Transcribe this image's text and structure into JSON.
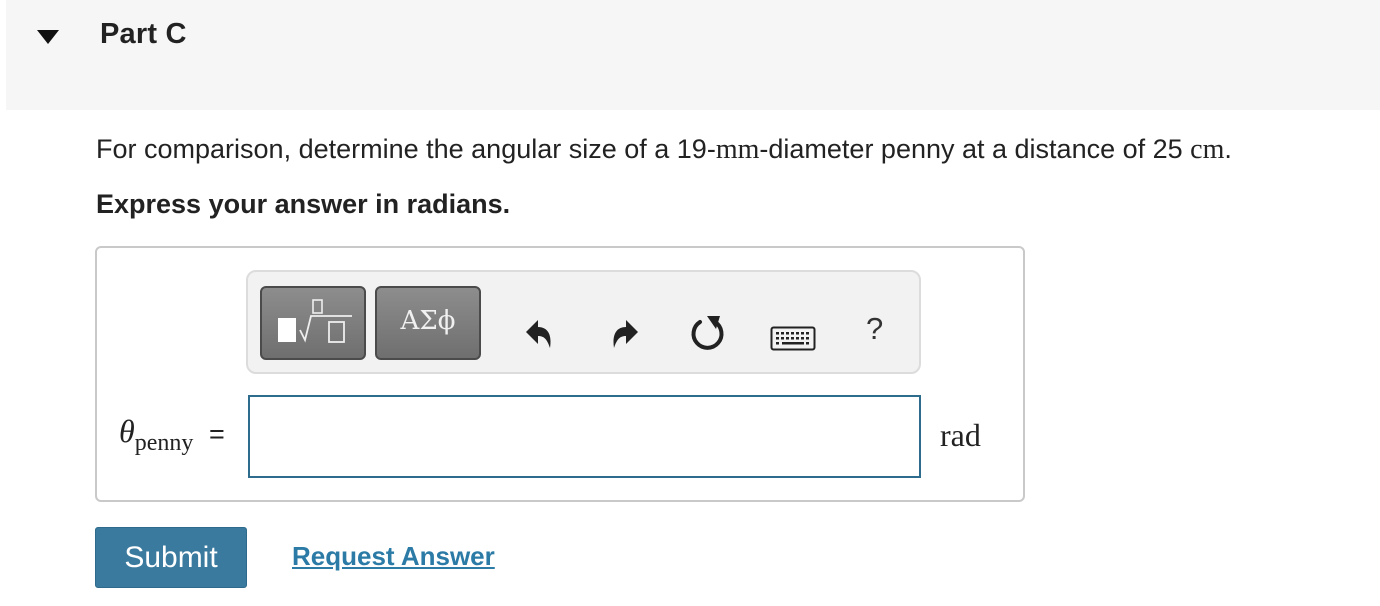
{
  "part": {
    "title": "Part C"
  },
  "question": {
    "text_before": "For comparison, determine the angular size of a 19-",
    "unit_mm": "mm",
    "text_middle": "-diameter penny at a distance of 25 ",
    "unit_cm": "cm",
    "text_after": "."
  },
  "instruction": "Express your answer in radians.",
  "toolbar": {
    "symbols_label": "ΑΣϕ",
    "help_label": "?",
    "icons": [
      "templates-icon",
      "undo-icon",
      "redo-icon",
      "reset-icon",
      "keyboard-icon",
      "help-icon"
    ]
  },
  "answer": {
    "variable_symbol": "θ",
    "variable_subscript": "penny",
    "equals": "=",
    "input_value": "",
    "unit": "rad"
  },
  "actions": {
    "submit_label": "Submit",
    "request_answer_label": "Request Answer"
  },
  "colors": {
    "header_bg": "#f6f6f6",
    "submit_bg": "#3a7a9e",
    "link": "#2b7ba6",
    "input_border": "#2e6c8e"
  }
}
